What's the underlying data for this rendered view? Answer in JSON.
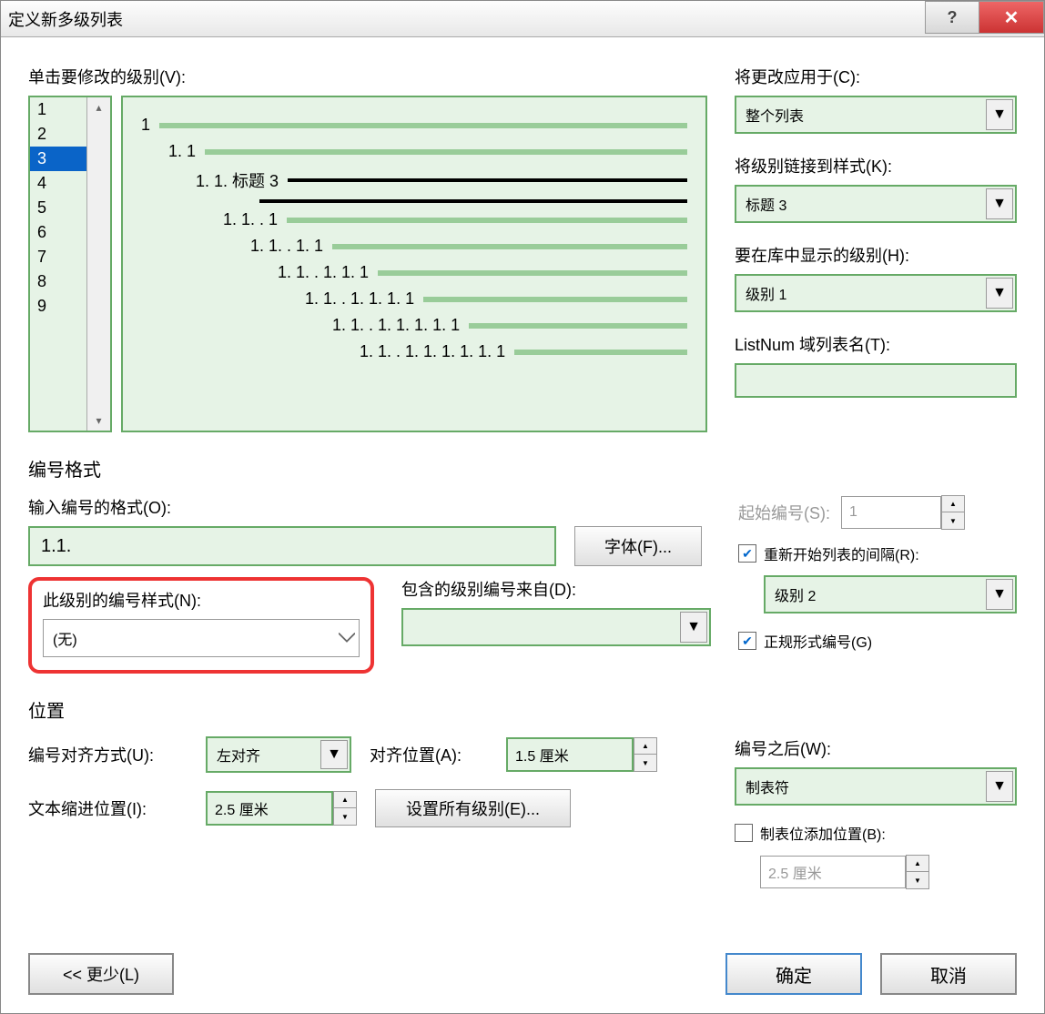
{
  "title": "定义新多级列表",
  "labels": {
    "click_level": "单击要修改的级别(V):",
    "apply_to": "将更改应用于(C):",
    "link_style": "将级别链接到样式(K):",
    "show_in_gallery": "要在库中显示的级别(H):",
    "listnum": "ListNum 域列表名(T):",
    "number_format_section": "编号格式",
    "enter_format": "输入编号的格式(O):",
    "font_btn": "字体(F)...",
    "start_at": "起始编号(S):",
    "restart_list": "重新开始列表的间隔(R):",
    "number_style": "此级别的编号样式(N):",
    "include_from": "包含的级别编号来自(D):",
    "legal_format": "正规形式编号(G)",
    "position_section": "位置",
    "number_alignment": "编号对齐方式(U):",
    "aligned_at": "对齐位置(A):",
    "text_indent": "文本缩进位置(I):",
    "set_all": "设置所有级别(E)...",
    "follow_number": "编号之后(W):",
    "add_tab_stop": "制表位添加位置(B):",
    "less_btn": "<< 更少(L)",
    "ok": "确定",
    "cancel": "取消"
  },
  "levels": [
    "1",
    "2",
    "3",
    "4",
    "5",
    "6",
    "7",
    "8",
    "9"
  ],
  "selected_level": "3",
  "preview": [
    {
      "indent": 0,
      "num": "1",
      "thick": false
    },
    {
      "indent": 1,
      "num": "1. 1",
      "thick": false
    },
    {
      "indent": 2,
      "num": "1. 1. 标题 3",
      "thick": true,
      "double": true
    },
    {
      "indent": 3,
      "num": "1. 1. . 1",
      "thick": false
    },
    {
      "indent": 4,
      "num": "1. 1. . 1. 1",
      "thick": false
    },
    {
      "indent": 5,
      "num": "1. 1. . 1. 1. 1",
      "thick": false
    },
    {
      "indent": 6,
      "num": "1. 1. . 1. 1. 1. 1",
      "thick": false
    },
    {
      "indent": 7,
      "num": "1. 1. . 1. 1. 1. 1. 1",
      "thick": false
    },
    {
      "indent": 8,
      "num": "1. 1. . 1. 1. 1. 1. 1. 1",
      "thick": false
    }
  ],
  "values": {
    "apply_to": "整个列表",
    "link_style": "标题 3",
    "show_in_gallery": "级别 1",
    "listnum": "",
    "format_text": "1.1.",
    "start_at": "1",
    "restart_level": "级别 2",
    "number_style": "(无)",
    "include_from": "",
    "alignment": "左对齐",
    "aligned_at": "1.5 厘米",
    "text_indent": "2.5 厘米",
    "follow_number": "制表符",
    "tab_stop": "2.5 厘米"
  },
  "checks": {
    "restart": true,
    "legal": true,
    "tab_stop": false
  }
}
